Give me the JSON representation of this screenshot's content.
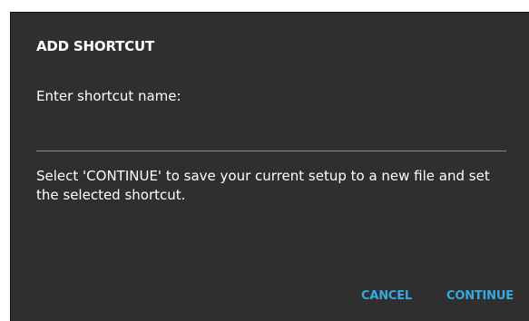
{
  "dialog": {
    "title": "ADD SHORTCUT",
    "prompt": "Enter shortcut name:",
    "name_value": "",
    "description": "Select 'CONTINUE' to save your current setup to a new file and set the selected shortcut.",
    "cancel_label": "CANCEL",
    "continue_label": "CONTINUE"
  },
  "colors": {
    "dialog_bg": "#2f2f2f",
    "accent": "#35a9e0",
    "text": "#ffffff"
  }
}
